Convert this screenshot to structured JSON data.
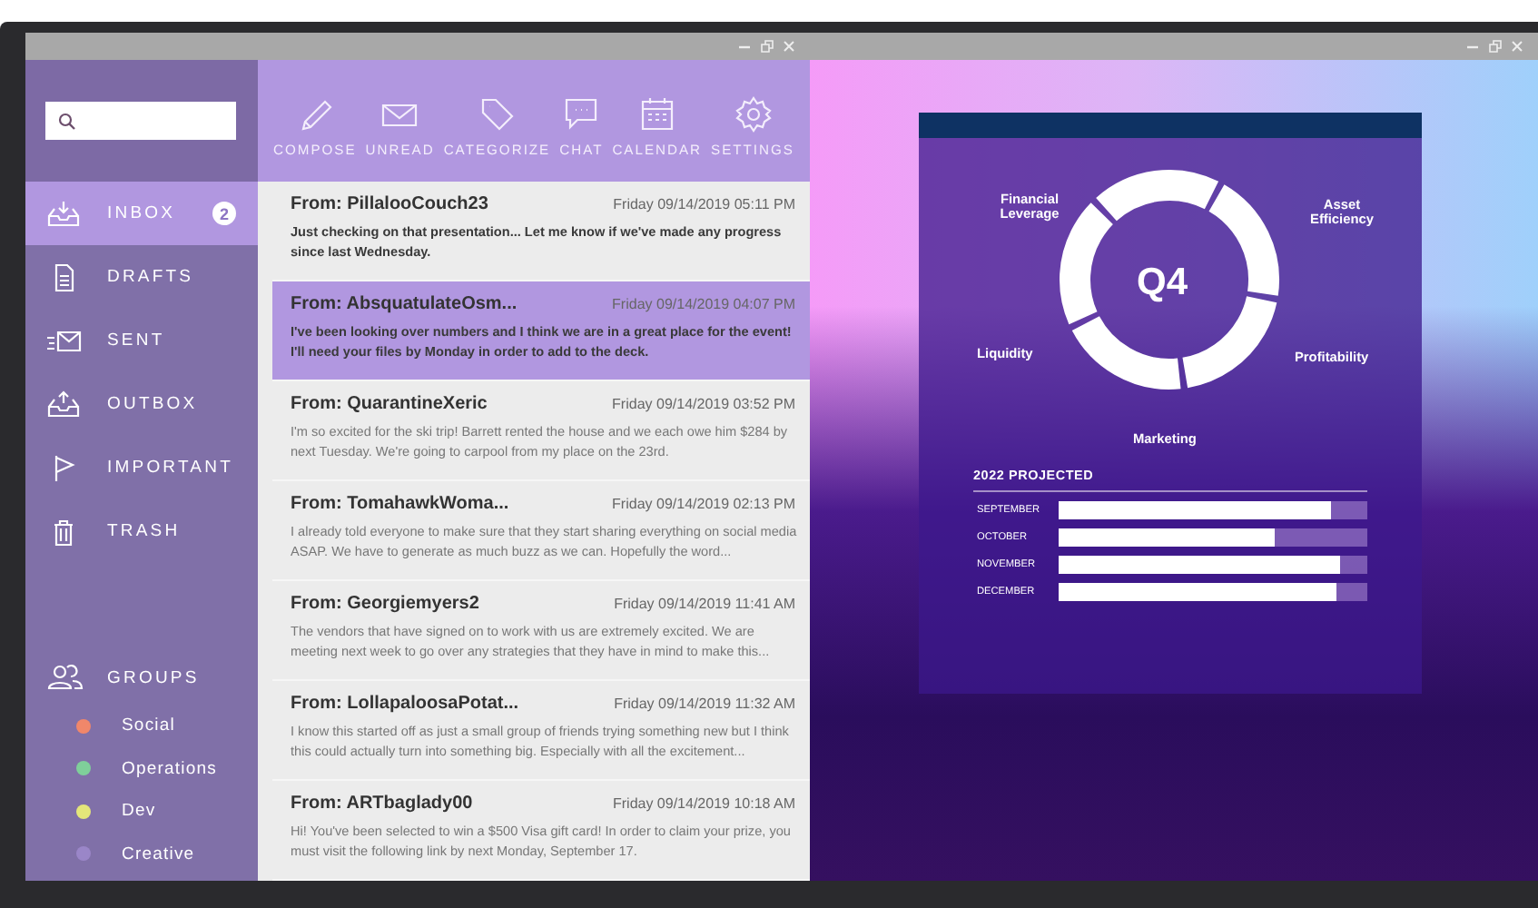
{
  "mail_window": {
    "nav": [
      {
        "label": "INBOX",
        "badge": "2",
        "selected": true
      },
      {
        "label": "DRAFTS",
        "selected": false
      },
      {
        "label": "SENT",
        "selected": false
      },
      {
        "label": "OUTBOX",
        "selected": false
      },
      {
        "label": "IMPORTANT",
        "selected": false
      },
      {
        "label": "TRASH",
        "selected": false
      }
    ],
    "groups": {
      "title": "GROUPS",
      "items": [
        {
          "label": "Social",
          "color": "#f0876a"
        },
        {
          "label": "Operations",
          "color": "#7fcf9a"
        },
        {
          "label": "Dev",
          "color": "#e4e67a"
        },
        {
          "label": "Creative",
          "color": "#9a86c8"
        }
      ]
    },
    "toolbar": [
      "COMPOSE",
      "UNREAD",
      "CATEGORIZE",
      "CHAT",
      "CALENDAR",
      "SETTINGS"
    ],
    "messages": [
      {
        "from": "From: PillalooCouch23",
        "date": "Friday 09/14/2019 05:11 PM",
        "preview": "Just checking on that presentation... Let me know if we've made any progress since last Wednesday.",
        "unread": true,
        "selected": false
      },
      {
        "from": "From: AbsquatulateOsm...",
        "date": "Friday 09/14/2019 04:07 PM",
        "preview": "I've been looking over numbers and I think we are in a great place for the event! I'll need your files by Monday in order to add to the deck.",
        "unread": true,
        "selected": true
      },
      {
        "from": "From: QuarantineXeric",
        "date": "Friday 09/14/2019 03:52 PM",
        "preview": "I'm so excited for the ski trip! Barrett rented the house and we each owe him $284 by next Tuesday. We're going to carpool from my place on the 23rd.",
        "unread": false,
        "selected": false
      },
      {
        "from": "From: TomahawkWoma...",
        "date": "Friday 09/14/2019 02:13 PM",
        "preview": "I already told everyone to make sure that they start sharing everything on social media ASAP. We have to generate as much buzz as we can. Hopefully the word...",
        "unread": false,
        "selected": false
      },
      {
        "from": "From: Georgiemyers2",
        "date": "Friday 09/14/2019 11:41 AM",
        "preview": "The vendors that have signed on to work with us are extremely excited. We are meeting next week to go over any strategies that they have in mind to make this...",
        "unread": false,
        "selected": false
      },
      {
        "from": "From: LollapaloosaPotat...",
        "date": "Friday 09/14/2019 11:32 AM",
        "preview": "I know this started off as just a small group of friends trying something new but I think this could actually turn into something big. Especially with all the excitement...",
        "unread": false,
        "selected": false
      },
      {
        "from": "From: ARTbaglady00",
        "date": "Friday 09/14/2019 10:18 AM",
        "preview": "Hi! You've been selected to win a $500 Visa gift card! In order to claim your prize, you must visit the following link by next Monday, September 17.",
        "unread": false,
        "selected": false
      }
    ]
  },
  "slide_window": {
    "cycle": {
      "center": "Q4",
      "labels": [
        "Financial Leverage",
        "Asset Efficiency",
        "Liquidity",
        "Profitability",
        "Marketing"
      ]
    },
    "projected": {
      "title": "2022 PROJECTED",
      "bars": [
        {
          "label": "SEPTEMBER",
          "level": 0.88
        },
        {
          "label": "OCTOBER",
          "level": 0.7
        },
        {
          "label": "NOVEMBER",
          "level": 0.91
        },
        {
          "label": "DECEMBER",
          "level": 0.9
        }
      ]
    }
  }
}
